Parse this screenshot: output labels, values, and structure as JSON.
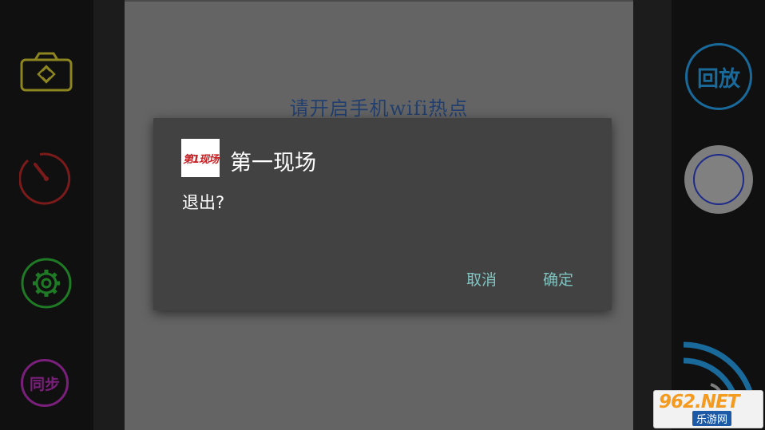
{
  "camera": {
    "hint_text": "请开启手机wifi热点"
  },
  "left_controls": {
    "sync_label": "同步"
  },
  "right_controls": {
    "playback_label": "回放"
  },
  "dialog": {
    "title": "第一现场",
    "icon_text": "第1现场",
    "message": "退出?",
    "cancel_label": "取消",
    "confirm_label": "确定"
  },
  "watermark": {
    "top_text": "962.NET",
    "bottom_text": "乐游网"
  },
  "colors": {
    "switch_camera": "#8c8520",
    "timer": "#7a1a1a",
    "settings": "#1f7a25",
    "sync": "#7a1f7c",
    "playback": "#19699a",
    "dialog_button": "#7fc4c0"
  }
}
